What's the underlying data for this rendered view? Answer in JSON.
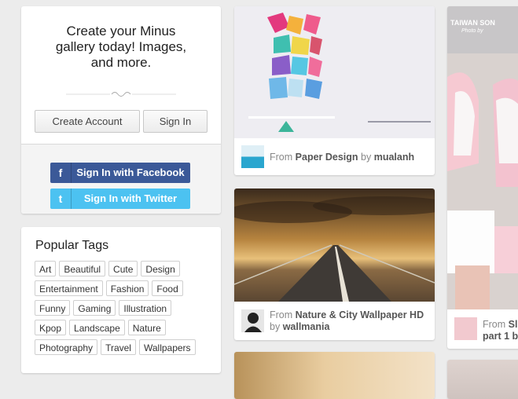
{
  "signup": {
    "headline": [
      "Create your Minus",
      "gallery today! Images,",
      "and more."
    ],
    "create_account": "Create Account",
    "sign_in": "Sign In",
    "facebook": "Sign In with Facebook",
    "twitter": "Sign In with Twitter",
    "facebook_icon": "f",
    "twitter_icon": "t",
    "colors": {
      "facebook": "#3b5998",
      "twitter": "#4cc2f1"
    }
  },
  "tags": {
    "title": "Popular Tags",
    "items": [
      "Art",
      "Beautiful",
      "Cute",
      "Design",
      "Entertainment",
      "Fashion",
      "Food",
      "Funny",
      "Gaming",
      "Illustration",
      "Kpop",
      "Landscape",
      "Nature",
      "Photography",
      "Travel",
      "Wallpapers"
    ]
  },
  "pins": {
    "p1": {
      "from": "From",
      "gallery": "Paper Design",
      "by": "by",
      "user": "mualanh"
    },
    "p2": {
      "from": "From",
      "gallery": "Nature & City Wallpaper HD",
      "by": "by",
      "user": "wallmania"
    },
    "p4": {
      "from": "From",
      "gallery": "Sl",
      "extra": "part 1 b",
      "watermark": "TAIWAN SON",
      "watermark_sub": "Photo by"
    }
  }
}
